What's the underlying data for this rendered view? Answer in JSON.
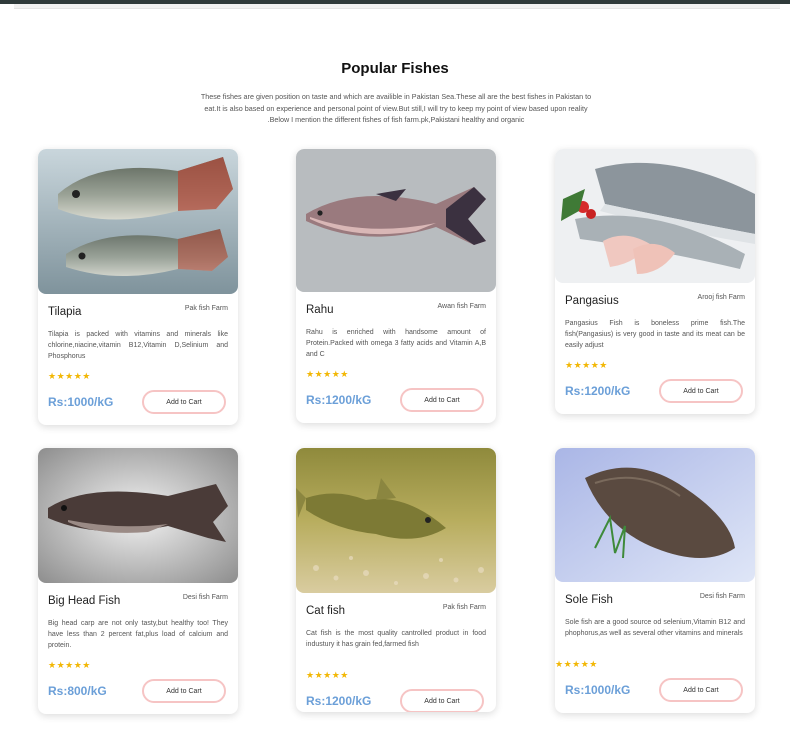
{
  "section": {
    "title": "Popular Fishes",
    "intro": "These fishes are given position on taste and which are availible in Pakistan Sea.These all are the best fishes in Pakistan to eat.It is also based on experience and personal point of view.But still,I will try to keep my point of view based upon reality .Below I mention the different fishes of fish farm.pk,Pakistani healthy and organic"
  },
  "products": [
    {
      "name": "Tilapia",
      "farm": "Pak fish Farm",
      "description": "Tilapia is packed with vitamins and minerals like chlorine,niacine,vitamin B12,Vitamin D,Selinium and Phosphorus",
      "rating": "★★★★★",
      "price": "Rs:1000/kG",
      "button": "Add to Cart",
      "image_icon": "tilapia-fish-image"
    },
    {
      "name": "Rahu",
      "farm": "Awan fish Farm",
      "description": "Rahu is enriched with handsome amount of Protein.Packed with omega 3 fatty acids and Vitamin A,B and C",
      "rating": "★★★★★",
      "price": "Rs:1200/kG",
      "button": "Add to Cart",
      "image_icon": "rahu-fish-image"
    },
    {
      "name": "Pangasius",
      "farm": "Arooj fish Farm",
      "description": "Pangasius Fish is boneless prime fish.The fish(Pangasius) is very good in taste and its meat can be easily adjust",
      "rating": "★★★★★",
      "price": "Rs:1200/kG",
      "button": "Add to Cart",
      "image_icon": "pangasius-fish-image"
    },
    {
      "name": "Big Head Fish",
      "farm": "Desi fish Farm",
      "description": "Big head carp are not only tasty,but healthy too! They have less than 2 percent fat,plus load of calcium and protein.",
      "rating": "★★★★★",
      "price": "Rs:800/kG",
      "button": "Add to Cart",
      "image_icon": "big-head-fish-image"
    },
    {
      "name": "Cat fish",
      "farm": "Pak fish Farm",
      "description": "Cat fish is the most quality cantrolled product in food industury it has grain fed,farmed fish",
      "rating": "★★★★★",
      "price": "Rs:1200/kG",
      "button": "Add to Cart",
      "image_icon": "cat-fish-image"
    },
    {
      "name": "Sole Fish",
      "farm": "Desi fish Farm",
      "description": "Sole fish are a good source od selenium,Vitamin B12 and phophorus,as well as several other vitamins and minerals",
      "rating": "★★★★★",
      "price": "Rs:1000/kG",
      "button": "Add to Cart",
      "image_icon": "sole-fish-image"
    }
  ]
}
